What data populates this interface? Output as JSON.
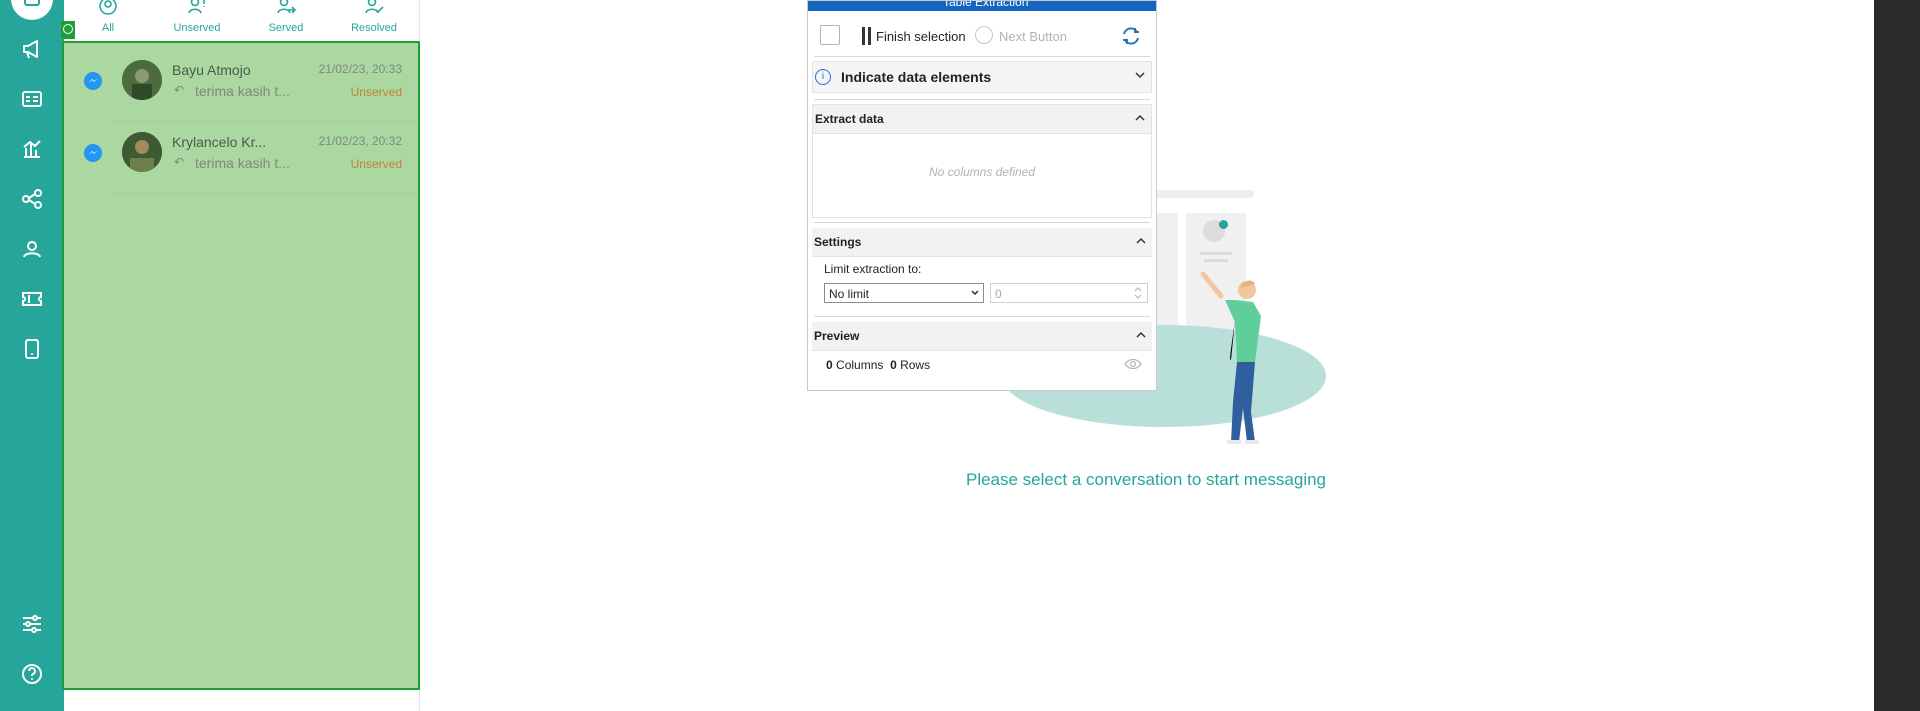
{
  "tabs": [
    {
      "label": "All",
      "icon": "user-circle-icon"
    },
    {
      "label": "Unserved",
      "icon": "user-alert-icon"
    },
    {
      "label": "Served",
      "icon": "user-arrow-icon"
    },
    {
      "label": "Resolved",
      "icon": "user-check-icon"
    }
  ],
  "conversations": [
    {
      "name": "Bayu Atmojo",
      "time": "21/02/23, 20:33",
      "snippet": "terima kasih t...",
      "status": "Unserved",
      "channel": "messenger-icon"
    },
    {
      "name": "Krylancelo Kr...",
      "time": "21/02/23, 20:32",
      "snippet": "terima kasih t...",
      "status": "Unserved",
      "channel": "messenger-icon"
    }
  ],
  "empty_state": {
    "message": "Please select a conversation to start messaging"
  },
  "dialog": {
    "title": "Table Extraction",
    "finish_label": "Finish selection",
    "next_label": "Next Button",
    "indicate_label": "Indicate data elements",
    "extract_title": "Extract data",
    "no_columns": "No columns defined",
    "settings_title": "Settings",
    "limit_label": "Limit extraction to:",
    "limit_value": "No limit",
    "limit_count": "0",
    "preview_title": "Preview",
    "columns_count": "0",
    "columns_word": "Columns",
    "rows_count": "0",
    "rows_word": "Rows"
  },
  "colors": {
    "sidebar": "#26a69a",
    "highlight": "#abd7a1",
    "highlight_border": "#1f9e36",
    "title_bar": "#1565c0"
  }
}
